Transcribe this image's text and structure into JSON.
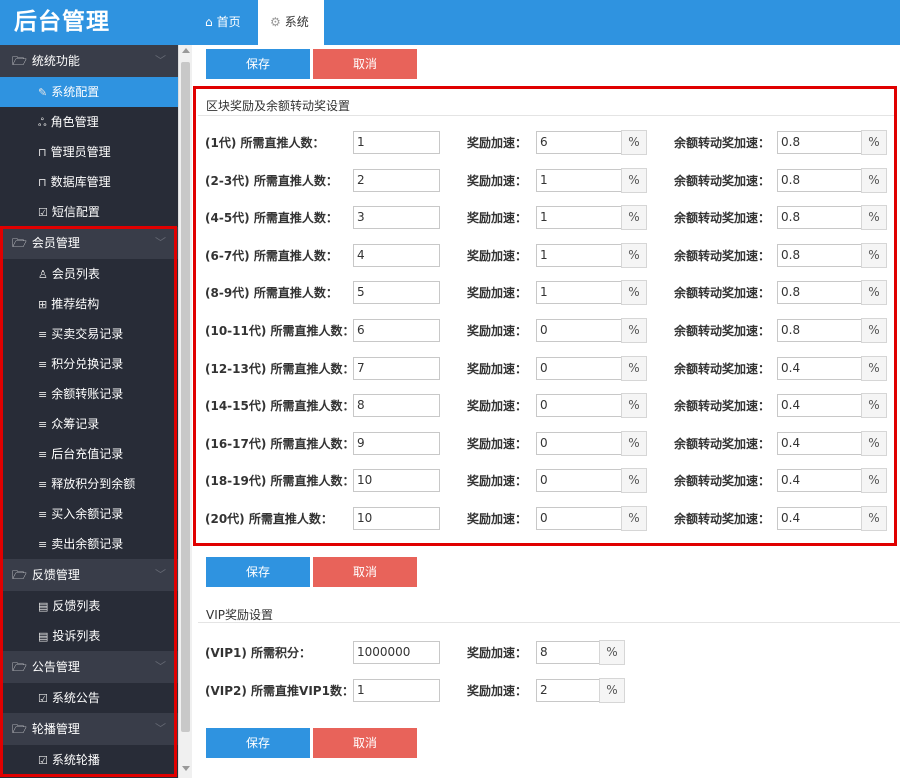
{
  "app_title": "后台管理",
  "tabs": [
    {
      "label": "首页",
      "icon": "home-icon"
    },
    {
      "label": "系统",
      "icon": "gear-icon"
    }
  ],
  "sidebar": {
    "groups": [
      {
        "label": "统统功能",
        "items": [
          {
            "label": "系统配置",
            "icon": "wrench-icon",
            "active": true
          },
          {
            "label": "角色管理",
            "icon": "org-icon"
          },
          {
            "label": "管理员管理",
            "icon": "lock-icon"
          },
          {
            "label": "数据库管理",
            "icon": "lock-icon"
          },
          {
            "label": "短信配置",
            "icon": "checkbox-icon"
          }
        ]
      },
      {
        "label": "会员管理",
        "items": [
          {
            "label": "会员列表",
            "icon": "user-icon"
          },
          {
            "label": "推荐结构",
            "icon": "grid-icon"
          },
          {
            "label": "买卖交易记录",
            "icon": "list-icon"
          },
          {
            "label": "积分兑换记录",
            "icon": "list-icon"
          },
          {
            "label": "余额转账记录",
            "icon": "list-icon"
          },
          {
            "label": "众筹记录",
            "icon": "list-icon"
          },
          {
            "label": "后台充值记录",
            "icon": "list-icon"
          },
          {
            "label": "释放积分到余额",
            "icon": "list-icon"
          },
          {
            "label": "买入余额记录",
            "icon": "list-icon"
          },
          {
            "label": "卖出余额记录",
            "icon": "list-icon"
          }
        ]
      },
      {
        "label": "反馈管理",
        "items": [
          {
            "label": "反馈列表",
            "icon": "doc-icon"
          },
          {
            "label": "投诉列表",
            "icon": "doc-icon"
          }
        ]
      },
      {
        "label": "公告管理",
        "items": [
          {
            "label": "系统公告",
            "icon": "checkbox-icon"
          }
        ]
      },
      {
        "label": "轮播管理",
        "items": [
          {
            "label": "系统轮播",
            "icon": "checkbox-icon"
          }
        ]
      }
    ]
  },
  "buttons": {
    "save": "保存",
    "cancel": "取消"
  },
  "block_section": {
    "title": "区块奖励及余额转动奖设置",
    "col2_label": "奖励加速：",
    "col3_label": "余额转动奖加速：",
    "unit": "%",
    "rows": [
      {
        "label": "(1代) 所需直推人数：",
        "count": "1",
        "reward": "6",
        "balance": "0.8"
      },
      {
        "label": "(2-3代) 所需直推人数：",
        "count": "2",
        "reward": "1",
        "balance": "0.8"
      },
      {
        "label": "(4-5代) 所需直推人数：",
        "count": "3",
        "reward": "1",
        "balance": "0.8"
      },
      {
        "label": "(6-7代) 所需直推人数：",
        "count": "4",
        "reward": "1",
        "balance": "0.8"
      },
      {
        "label": "(8-9代) 所需直推人数：",
        "count": "5",
        "reward": "1",
        "balance": "0.8"
      },
      {
        "label": "(10-11代) 所需直推人数：",
        "count": "6",
        "reward": "0",
        "balance": "0.8"
      },
      {
        "label": "(12-13代) 所需直推人数：",
        "count": "7",
        "reward": "0",
        "balance": "0.4"
      },
      {
        "label": "(14-15代) 所需直推人数：",
        "count": "8",
        "reward": "0",
        "balance": "0.4"
      },
      {
        "label": "(16-17代) 所需直推人数：",
        "count": "9",
        "reward": "0",
        "balance": "0.4"
      },
      {
        "label": "(18-19代) 所需直推人数：",
        "count": "10",
        "reward": "0",
        "balance": "0.4"
      },
      {
        "label": "(20代) 所需直推人数：",
        "count": "10",
        "reward": "0",
        "balance": "0.4"
      }
    ]
  },
  "vip_section": {
    "title": "VIP奖励设置",
    "col2_label": "奖励加速：",
    "unit": "%",
    "rows": [
      {
        "label": "(VIP1) 所需积分：",
        "value": "1000000",
        "reward": "8"
      },
      {
        "label": "(VIP2) 所需直推VIP1数：",
        "value": "1",
        "reward": "2"
      }
    ]
  },
  "colors": {
    "primary": "#2f93e0",
    "danger": "#e8635a",
    "sidebar": "#282c37",
    "highlight": "#e00000"
  }
}
